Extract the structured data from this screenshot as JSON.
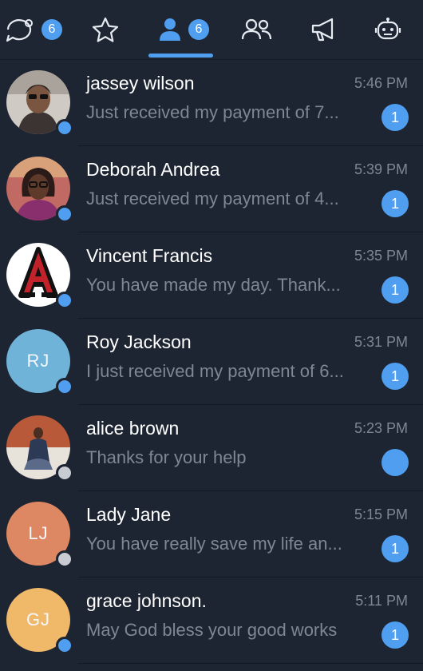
{
  "tabs": [
    {
      "icon": "chat-bubble-icon",
      "badge": "6"
    },
    {
      "icon": "star-icon",
      "badge": ""
    },
    {
      "icon": "person-icon",
      "badge": "6",
      "active": true
    },
    {
      "icon": "people-icon",
      "badge": ""
    },
    {
      "icon": "megaphone-icon",
      "badge": ""
    },
    {
      "icon": "bot-icon",
      "badge": ""
    }
  ],
  "colors": {
    "background": "#1e2532",
    "accent": "#4f9ef0",
    "secondary_text": "#7d8796",
    "online_dot": "#4f9ef0",
    "offline_dot": "#c8ccd2"
  },
  "chats": [
    {
      "name": "jassey wilson",
      "preview": "Just received my payment of 7...",
      "time": "5:46 PM",
      "unread": "1",
      "avatar": "photo",
      "status": "online"
    },
    {
      "name": "Deborah Andrea",
      "preview": "Just received my payment of 4...",
      "time": "5:39 PM",
      "unread": "1",
      "avatar": "photo",
      "status": "online"
    },
    {
      "name": "Vincent Francis",
      "preview": "You have made my day. Thank...",
      "time": "5:35 PM",
      "unread": "1",
      "avatar": "logo",
      "status": "online"
    },
    {
      "name": "Roy Jackson",
      "preview": "I just received my payment of 6...",
      "time": "5:31 PM",
      "unread": "1",
      "avatar_initials": "RJ",
      "avatar_color": "#6fb3d9",
      "status": "online"
    },
    {
      "name": "alice brown",
      "preview": "Thanks for your help",
      "time": "5:23 PM",
      "unread": "",
      "avatar": "photo",
      "status": "offline"
    },
    {
      "name": "Lady Jane",
      "preview": "You have really save my life an...",
      "time": "5:15 PM",
      "unread": "1",
      "avatar_initials": "LJ",
      "avatar_color": "#dd8862",
      "status": "offline"
    },
    {
      "name": "grace johnson.",
      "preview": "May God bless your good works",
      "time": "5:11 PM",
      "unread": "1",
      "avatar_initials": "GJ",
      "avatar_color": "#f0b96a",
      "status": "online"
    }
  ]
}
